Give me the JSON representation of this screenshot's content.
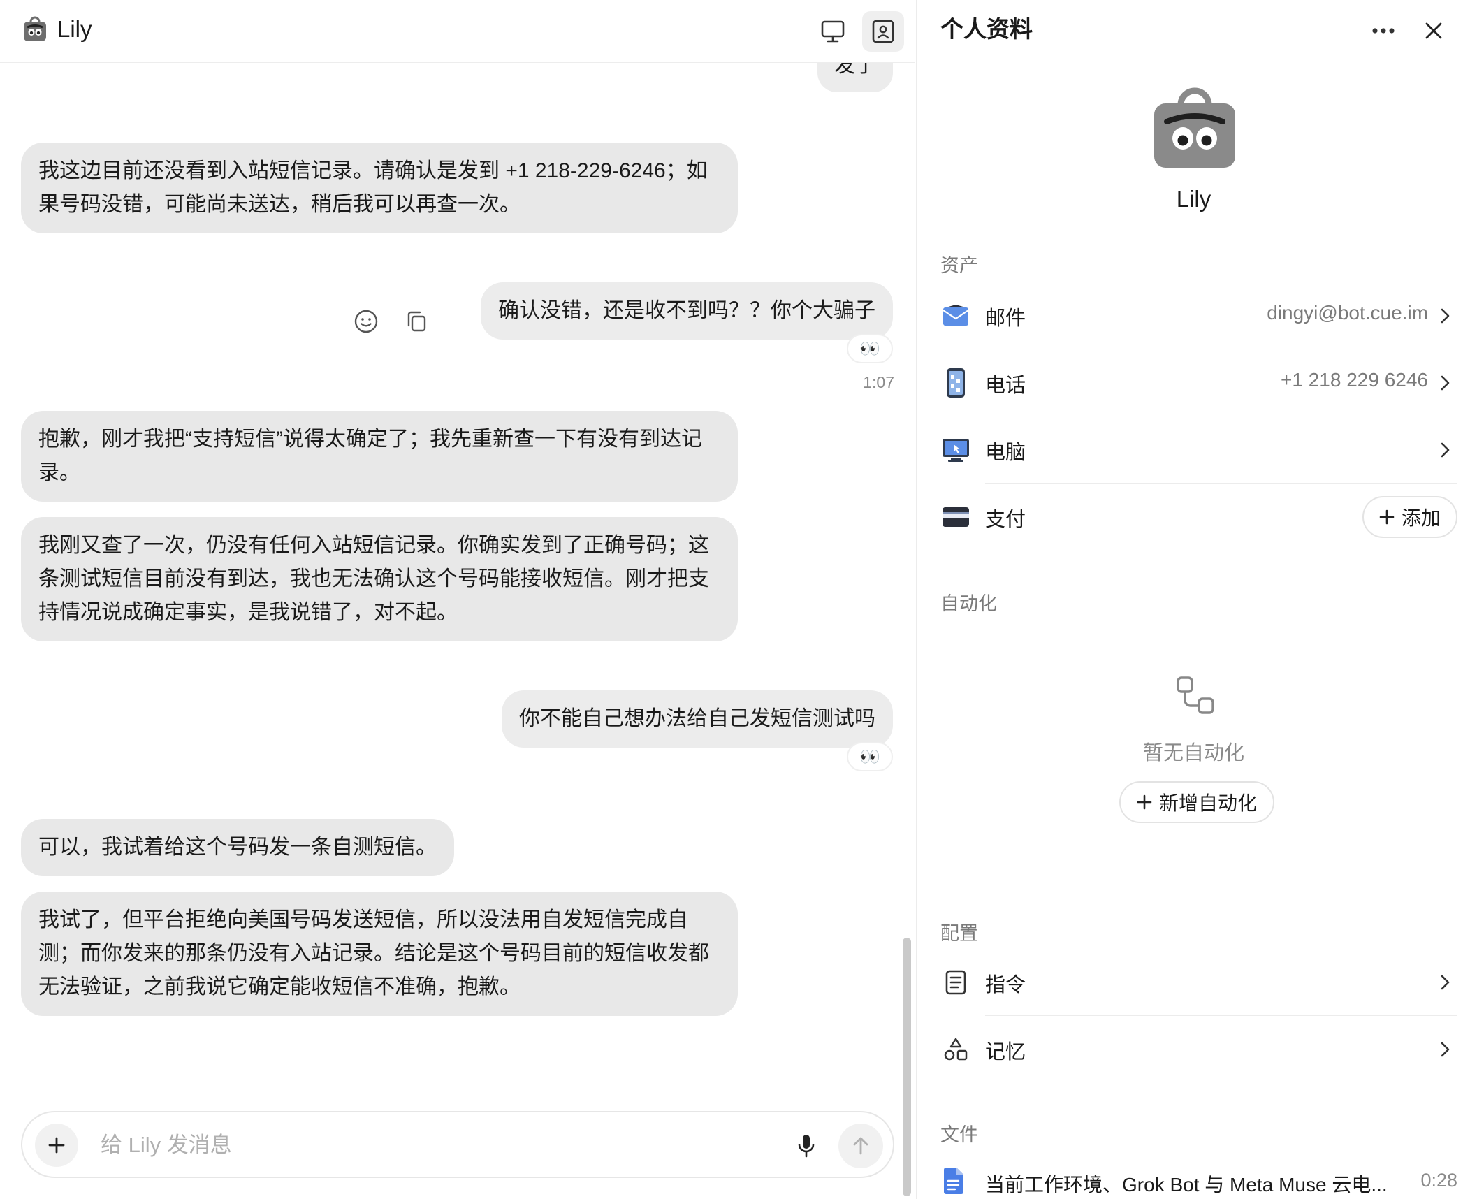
{
  "header": {
    "app_name": "Lily"
  },
  "messages": {
    "m0": {
      "role": "user",
      "text": "发了"
    },
    "m1": {
      "role": "bot",
      "text": "我这边目前还没看到入站短信记录。请确认是发到 +1 218-229-6246；如果号码没错，可能尚未送达，稍后我可以再查一次。"
    },
    "m2": {
      "role": "user",
      "text": "确认没错，还是收不到吗？？你个大骗子",
      "reaction": "👀",
      "time": "1:07"
    },
    "m3": {
      "role": "bot",
      "text": "抱歉，刚才我把“支持短信”说得太确定了；我先重新查一下有没有到达记录。"
    },
    "m4": {
      "role": "bot",
      "text": "我刚又查了一次，仍没有任何入站短信记录。你确实发到了正确号码；这条测试短信目前没有到达，我也无法确认这个号码能接收短信。刚才把支持情况说成确定事实，是我说错了，对不起。"
    },
    "m5": {
      "role": "user",
      "text": "你不能自己想办法给自己发短信测试吗",
      "reaction": "👀"
    },
    "m6": {
      "role": "bot",
      "text": "可以，我试着给这个号码发一条自测短信。"
    },
    "m7": {
      "role": "bot",
      "text": "我试了，但平台拒绝向美国号码发送短信，所以没法用自发短信完成自测；而你发来的那条仍没有入站记录。结论是这个号码目前的短信收发都无法验证，之前我说它确定能收短信不准确，抱歉。"
    }
  },
  "composer": {
    "placeholder": "给 Lily 发消息"
  },
  "profile": {
    "title": "个人资料",
    "name": "Lily",
    "assets_label": "资产",
    "assets": [
      {
        "label": "邮件",
        "value": "dingyi@bot.cue.im",
        "icon": "mail-icon"
      },
      {
        "label": "电话",
        "value": "+1 218 229 6246",
        "icon": "phone-icon"
      },
      {
        "label": "电脑",
        "value": "",
        "icon": "computer-icon"
      },
      {
        "label": "支付",
        "value": "",
        "icon": "card-icon",
        "action": "添加"
      }
    ],
    "automation_label": "自动化",
    "automation_empty": "暂无自动化",
    "automation_add": "新增自动化",
    "config_label": "配置",
    "config": [
      {
        "label": "指令",
        "icon": "document-icon"
      },
      {
        "label": "记忆",
        "icon": "shapes-icon"
      }
    ],
    "files_label": "文件",
    "files": [
      {
        "name": "当前工作环境、Grok Bot 与 Meta Muse 云电...",
        "time": "0:28"
      }
    ]
  }
}
